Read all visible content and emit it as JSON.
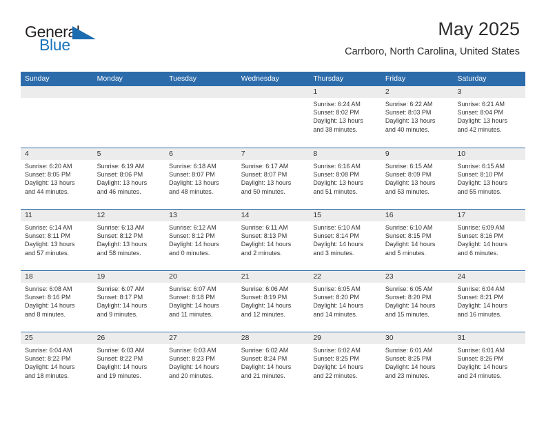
{
  "logo": {
    "word_top": "General",
    "word_bottom": "Blue",
    "flag_icon": "blue-triangle-flag-icon",
    "color_primary": "#1b6cb0",
    "color_text": "#231f20"
  },
  "header": {
    "title": "May 2025",
    "subtitle": "Carrboro, North Carolina, United States",
    "accent_color": "#2d6cab",
    "band_color": "#ececec"
  },
  "calendar": {
    "weekdays": [
      "Sunday",
      "Monday",
      "Tuesday",
      "Wednesday",
      "Thursday",
      "Friday",
      "Saturday"
    ],
    "weeks": [
      [
        {
          "day": "",
          "lines": []
        },
        {
          "day": "",
          "lines": []
        },
        {
          "day": "",
          "lines": []
        },
        {
          "day": "",
          "lines": []
        },
        {
          "day": "1",
          "lines": [
            "Sunrise: 6:24 AM",
            "Sunset: 8:02 PM",
            "Daylight: 13 hours",
            "and 38 minutes."
          ]
        },
        {
          "day": "2",
          "lines": [
            "Sunrise: 6:22 AM",
            "Sunset: 8:03 PM",
            "Daylight: 13 hours",
            "and 40 minutes."
          ]
        },
        {
          "day": "3",
          "lines": [
            "Sunrise: 6:21 AM",
            "Sunset: 8:04 PM",
            "Daylight: 13 hours",
            "and 42 minutes."
          ]
        }
      ],
      [
        {
          "day": "4",
          "lines": [
            "Sunrise: 6:20 AM",
            "Sunset: 8:05 PM",
            "Daylight: 13 hours",
            "and 44 minutes."
          ]
        },
        {
          "day": "5",
          "lines": [
            "Sunrise: 6:19 AM",
            "Sunset: 8:06 PM",
            "Daylight: 13 hours",
            "and 46 minutes."
          ]
        },
        {
          "day": "6",
          "lines": [
            "Sunrise: 6:18 AM",
            "Sunset: 8:07 PM",
            "Daylight: 13 hours",
            "and 48 minutes."
          ]
        },
        {
          "day": "7",
          "lines": [
            "Sunrise: 6:17 AM",
            "Sunset: 8:07 PM",
            "Daylight: 13 hours",
            "and 50 minutes."
          ]
        },
        {
          "day": "8",
          "lines": [
            "Sunrise: 6:16 AM",
            "Sunset: 8:08 PM",
            "Daylight: 13 hours",
            "and 51 minutes."
          ]
        },
        {
          "day": "9",
          "lines": [
            "Sunrise: 6:15 AM",
            "Sunset: 8:09 PM",
            "Daylight: 13 hours",
            "and 53 minutes."
          ]
        },
        {
          "day": "10",
          "lines": [
            "Sunrise: 6:15 AM",
            "Sunset: 8:10 PM",
            "Daylight: 13 hours",
            "and 55 minutes."
          ]
        }
      ],
      [
        {
          "day": "11",
          "lines": [
            "Sunrise: 6:14 AM",
            "Sunset: 8:11 PM",
            "Daylight: 13 hours",
            "and 57 minutes."
          ]
        },
        {
          "day": "12",
          "lines": [
            "Sunrise: 6:13 AM",
            "Sunset: 8:12 PM",
            "Daylight: 13 hours",
            "and 58 minutes."
          ]
        },
        {
          "day": "13",
          "lines": [
            "Sunrise: 6:12 AM",
            "Sunset: 8:12 PM",
            "Daylight: 14 hours",
            "and 0 minutes."
          ]
        },
        {
          "day": "14",
          "lines": [
            "Sunrise: 6:11 AM",
            "Sunset: 8:13 PM",
            "Daylight: 14 hours",
            "and 2 minutes."
          ]
        },
        {
          "day": "15",
          "lines": [
            "Sunrise: 6:10 AM",
            "Sunset: 8:14 PM",
            "Daylight: 14 hours",
            "and 3 minutes."
          ]
        },
        {
          "day": "16",
          "lines": [
            "Sunrise: 6:10 AM",
            "Sunset: 8:15 PM",
            "Daylight: 14 hours",
            "and 5 minutes."
          ]
        },
        {
          "day": "17",
          "lines": [
            "Sunrise: 6:09 AM",
            "Sunset: 8:16 PM",
            "Daylight: 14 hours",
            "and 6 minutes."
          ]
        }
      ],
      [
        {
          "day": "18",
          "lines": [
            "Sunrise: 6:08 AM",
            "Sunset: 8:16 PM",
            "Daylight: 14 hours",
            "and 8 minutes."
          ]
        },
        {
          "day": "19",
          "lines": [
            "Sunrise: 6:07 AM",
            "Sunset: 8:17 PM",
            "Daylight: 14 hours",
            "and 9 minutes."
          ]
        },
        {
          "day": "20",
          "lines": [
            "Sunrise: 6:07 AM",
            "Sunset: 8:18 PM",
            "Daylight: 14 hours",
            "and 11 minutes."
          ]
        },
        {
          "day": "21",
          "lines": [
            "Sunrise: 6:06 AM",
            "Sunset: 8:19 PM",
            "Daylight: 14 hours",
            "and 12 minutes."
          ]
        },
        {
          "day": "22",
          "lines": [
            "Sunrise: 6:05 AM",
            "Sunset: 8:20 PM",
            "Daylight: 14 hours",
            "and 14 minutes."
          ]
        },
        {
          "day": "23",
          "lines": [
            "Sunrise: 6:05 AM",
            "Sunset: 8:20 PM",
            "Daylight: 14 hours",
            "and 15 minutes."
          ]
        },
        {
          "day": "24",
          "lines": [
            "Sunrise: 6:04 AM",
            "Sunset: 8:21 PM",
            "Daylight: 14 hours",
            "and 16 minutes."
          ]
        }
      ],
      [
        {
          "day": "25",
          "lines": [
            "Sunrise: 6:04 AM",
            "Sunset: 8:22 PM",
            "Daylight: 14 hours",
            "and 18 minutes."
          ]
        },
        {
          "day": "26",
          "lines": [
            "Sunrise: 6:03 AM",
            "Sunset: 8:22 PM",
            "Daylight: 14 hours",
            "and 19 minutes."
          ]
        },
        {
          "day": "27",
          "lines": [
            "Sunrise: 6:03 AM",
            "Sunset: 8:23 PM",
            "Daylight: 14 hours",
            "and 20 minutes."
          ]
        },
        {
          "day": "28",
          "lines": [
            "Sunrise: 6:02 AM",
            "Sunset: 8:24 PM",
            "Daylight: 14 hours",
            "and 21 minutes."
          ]
        },
        {
          "day": "29",
          "lines": [
            "Sunrise: 6:02 AM",
            "Sunset: 8:25 PM",
            "Daylight: 14 hours",
            "and 22 minutes."
          ]
        },
        {
          "day": "30",
          "lines": [
            "Sunrise: 6:01 AM",
            "Sunset: 8:25 PM",
            "Daylight: 14 hours",
            "and 23 minutes."
          ]
        },
        {
          "day": "31",
          "lines": [
            "Sunrise: 6:01 AM",
            "Sunset: 8:26 PM",
            "Daylight: 14 hours",
            "and 24 minutes."
          ]
        }
      ]
    ]
  }
}
